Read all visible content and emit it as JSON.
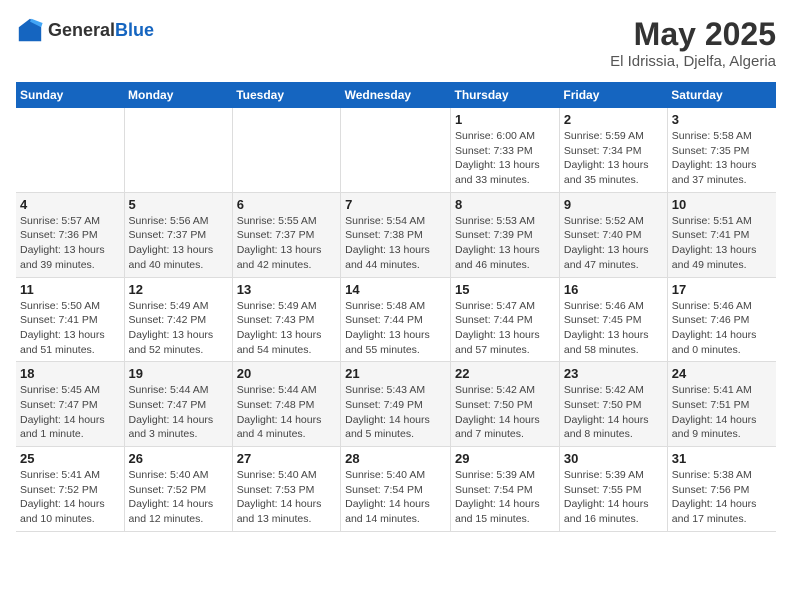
{
  "header": {
    "logo_general": "General",
    "logo_blue": "Blue",
    "month": "May 2025",
    "location": "El Idrissia, Djelfa, Algeria"
  },
  "days_of_week": [
    "Sunday",
    "Monday",
    "Tuesday",
    "Wednesday",
    "Thursday",
    "Friday",
    "Saturday"
  ],
  "weeks": [
    [
      {
        "day": "",
        "info": ""
      },
      {
        "day": "",
        "info": ""
      },
      {
        "day": "",
        "info": ""
      },
      {
        "day": "",
        "info": ""
      },
      {
        "day": "1",
        "info": "Sunrise: 6:00 AM\nSunset: 7:33 PM\nDaylight: 13 hours\nand 33 minutes."
      },
      {
        "day": "2",
        "info": "Sunrise: 5:59 AM\nSunset: 7:34 PM\nDaylight: 13 hours\nand 35 minutes."
      },
      {
        "day": "3",
        "info": "Sunrise: 5:58 AM\nSunset: 7:35 PM\nDaylight: 13 hours\nand 37 minutes."
      }
    ],
    [
      {
        "day": "4",
        "info": "Sunrise: 5:57 AM\nSunset: 7:36 PM\nDaylight: 13 hours\nand 39 minutes."
      },
      {
        "day": "5",
        "info": "Sunrise: 5:56 AM\nSunset: 7:37 PM\nDaylight: 13 hours\nand 40 minutes."
      },
      {
        "day": "6",
        "info": "Sunrise: 5:55 AM\nSunset: 7:37 PM\nDaylight: 13 hours\nand 42 minutes."
      },
      {
        "day": "7",
        "info": "Sunrise: 5:54 AM\nSunset: 7:38 PM\nDaylight: 13 hours\nand 44 minutes."
      },
      {
        "day": "8",
        "info": "Sunrise: 5:53 AM\nSunset: 7:39 PM\nDaylight: 13 hours\nand 46 minutes."
      },
      {
        "day": "9",
        "info": "Sunrise: 5:52 AM\nSunset: 7:40 PM\nDaylight: 13 hours\nand 47 minutes."
      },
      {
        "day": "10",
        "info": "Sunrise: 5:51 AM\nSunset: 7:41 PM\nDaylight: 13 hours\nand 49 minutes."
      }
    ],
    [
      {
        "day": "11",
        "info": "Sunrise: 5:50 AM\nSunset: 7:41 PM\nDaylight: 13 hours\nand 51 minutes."
      },
      {
        "day": "12",
        "info": "Sunrise: 5:49 AM\nSunset: 7:42 PM\nDaylight: 13 hours\nand 52 minutes."
      },
      {
        "day": "13",
        "info": "Sunrise: 5:49 AM\nSunset: 7:43 PM\nDaylight: 13 hours\nand 54 minutes."
      },
      {
        "day": "14",
        "info": "Sunrise: 5:48 AM\nSunset: 7:44 PM\nDaylight: 13 hours\nand 55 minutes."
      },
      {
        "day": "15",
        "info": "Sunrise: 5:47 AM\nSunset: 7:44 PM\nDaylight: 13 hours\nand 57 minutes."
      },
      {
        "day": "16",
        "info": "Sunrise: 5:46 AM\nSunset: 7:45 PM\nDaylight: 13 hours\nand 58 minutes."
      },
      {
        "day": "17",
        "info": "Sunrise: 5:46 AM\nSunset: 7:46 PM\nDaylight: 14 hours\nand 0 minutes."
      }
    ],
    [
      {
        "day": "18",
        "info": "Sunrise: 5:45 AM\nSunset: 7:47 PM\nDaylight: 14 hours\nand 1 minute."
      },
      {
        "day": "19",
        "info": "Sunrise: 5:44 AM\nSunset: 7:47 PM\nDaylight: 14 hours\nand 3 minutes."
      },
      {
        "day": "20",
        "info": "Sunrise: 5:44 AM\nSunset: 7:48 PM\nDaylight: 14 hours\nand 4 minutes."
      },
      {
        "day": "21",
        "info": "Sunrise: 5:43 AM\nSunset: 7:49 PM\nDaylight: 14 hours\nand 5 minutes."
      },
      {
        "day": "22",
        "info": "Sunrise: 5:42 AM\nSunset: 7:50 PM\nDaylight: 14 hours\nand 7 minutes."
      },
      {
        "day": "23",
        "info": "Sunrise: 5:42 AM\nSunset: 7:50 PM\nDaylight: 14 hours\nand 8 minutes."
      },
      {
        "day": "24",
        "info": "Sunrise: 5:41 AM\nSunset: 7:51 PM\nDaylight: 14 hours\nand 9 minutes."
      }
    ],
    [
      {
        "day": "25",
        "info": "Sunrise: 5:41 AM\nSunset: 7:52 PM\nDaylight: 14 hours\nand 10 minutes."
      },
      {
        "day": "26",
        "info": "Sunrise: 5:40 AM\nSunset: 7:52 PM\nDaylight: 14 hours\nand 12 minutes."
      },
      {
        "day": "27",
        "info": "Sunrise: 5:40 AM\nSunset: 7:53 PM\nDaylight: 14 hours\nand 13 minutes."
      },
      {
        "day": "28",
        "info": "Sunrise: 5:40 AM\nSunset: 7:54 PM\nDaylight: 14 hours\nand 14 minutes."
      },
      {
        "day": "29",
        "info": "Sunrise: 5:39 AM\nSunset: 7:54 PM\nDaylight: 14 hours\nand 15 minutes."
      },
      {
        "day": "30",
        "info": "Sunrise: 5:39 AM\nSunset: 7:55 PM\nDaylight: 14 hours\nand 16 minutes."
      },
      {
        "day": "31",
        "info": "Sunrise: 5:38 AM\nSunset: 7:56 PM\nDaylight: 14 hours\nand 17 minutes."
      }
    ]
  ]
}
